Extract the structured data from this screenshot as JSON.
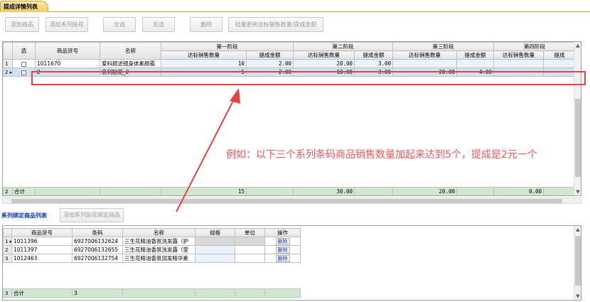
{
  "tab": {
    "label": "提成详情列表"
  },
  "toolbar": {
    "buttons": [
      "添加商品",
      "添加系列贴花",
      "全选",
      "反选",
      "删除",
      "批量更新达标销售数量/提成金额"
    ]
  },
  "grid1": {
    "headers": {
      "select": "选",
      "sku": "商品货号",
      "name": "名称",
      "stage1": "第一阶段",
      "stage2": "第二阶段",
      "stage3": "第三阶段",
      "stage4": "第四阶段",
      "qty": "达标销售数量",
      "amount": "提成金额",
      "amount_trunc": "提成"
    },
    "rows": [
      {
        "idx": "1",
        "sku": "1011670",
        "name": "爱科颜滤镜身体素颜霜",
        "s1q": "10",
        "s1a": "2.00",
        "s2q": "20.00",
        "s2a": "3.00",
        "s3q": "",
        "s3a": ""
      },
      {
        "idx": "2 ▸",
        "sku": "2",
        "name": "系列贴花_2",
        "s1q": "5",
        "s1a": "2.00",
        "s2q": "10.00",
        "s2a": "3.00",
        "s3q": "20.00",
        "s3a": "4.00"
      }
    ],
    "total": {
      "idx": "2",
      "label": "合计",
      "s1q": "15",
      "s2q": "30.00",
      "s3q": "20.00",
      "s4q": "0.00"
    }
  },
  "annotation": "例如：以下三个系列条码商品销售数量加起来达到5个，提成是2元一个",
  "section2": {
    "title": "系列绑定商品列表",
    "button": "添加系列贴花绑定商品",
    "headers": {
      "sku": "商品货号",
      "barcode": "条码",
      "name": "名称",
      "spec": "规格",
      "unit": "单位",
      "op": "操作"
    },
    "rows": [
      {
        "idx": "1 ▸",
        "sku": "1011396",
        "barcode": "6927006132624",
        "name": "三生花精油香氛洗发露（护",
        "del": "删除"
      },
      {
        "idx": "2",
        "sku": "1011397",
        "barcode": "6927006132655",
        "name": "三生花精油香氛洗发露（莹",
        "del": "删除"
      },
      {
        "idx": "3",
        "sku": "1012463",
        "barcode": "6927006132754",
        "name": "三生花精油香氛润发精华素",
        "del": "删除"
      }
    ],
    "total": {
      "idx": "3",
      "label": "合计",
      "count": "3"
    }
  }
}
